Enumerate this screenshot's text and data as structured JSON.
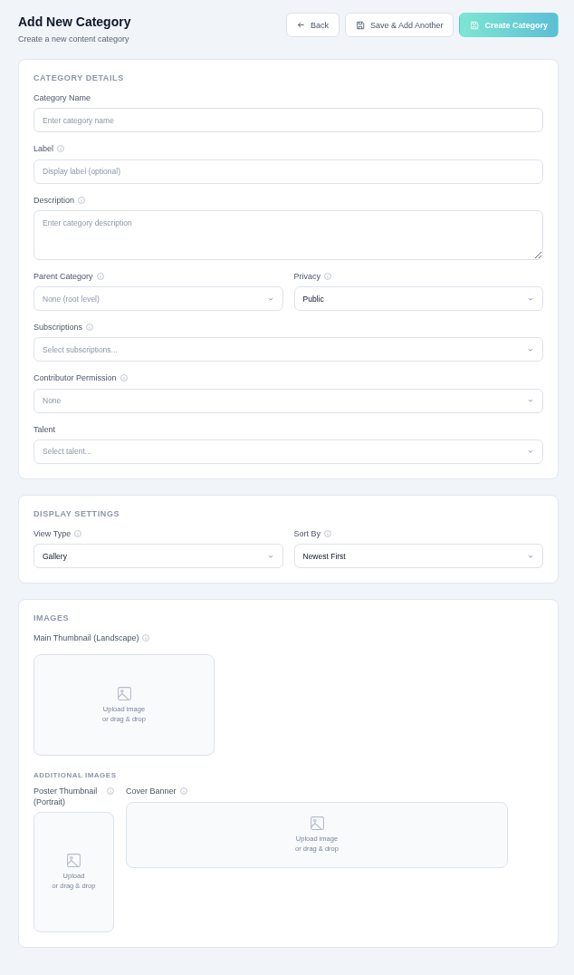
{
  "header": {
    "title": "Add New Category",
    "subtitle": "Create a new content category"
  },
  "actions": [
    {
      "label": "Back",
      "kind": "back"
    },
    {
      "label": "Save & Add Another",
      "kind": "secondary"
    },
    {
      "label": "Create Category",
      "kind": "primary"
    }
  ],
  "sections": [
    {
      "title": "CATEGORY DETAILS",
      "rows": [
        [
          {
            "label": "Category Name",
            "info": false,
            "kind": "input",
            "placeholder": "Enter category name"
          }
        ],
        [
          {
            "label": "Label",
            "info": true,
            "kind": "input",
            "placeholder": "Display label (optional)"
          }
        ],
        [
          {
            "label": "Description",
            "info": true,
            "kind": "textarea",
            "placeholder": "Enter category description"
          }
        ],
        [
          {
            "label": "Parent Category",
            "info": true,
            "kind": "select",
            "placeholder": "None (root level)"
          },
          {
            "label": "Privacy",
            "info": true,
            "kind": "select",
            "value": "Public"
          }
        ],
        [
          {
            "label": "Subscriptions",
            "info": true,
            "kind": "select",
            "placeholder": "Select subscriptions..."
          }
        ],
        [
          {
            "label": "Contributor Permission",
            "info": true,
            "kind": "select",
            "placeholder": "None"
          }
        ],
        [
          {
            "label": "Talent",
            "info": false,
            "kind": "select",
            "placeholder": "Select talent..."
          }
        ]
      ]
    },
    {
      "title": "DISPLAY SETTINGS",
      "rows": [
        [
          {
            "label": "View Type",
            "info": true,
            "kind": "select",
            "value": "Gallery"
          },
          {
            "label": "Sort By",
            "info": true,
            "kind": "select",
            "value": "Newest First"
          }
        ]
      ]
    }
  ],
  "images": {
    "title": "IMAGES",
    "main": {
      "label": "Main Thumbnail (Landscape)",
      "info": true,
      "kind": "landscape",
      "text": [
        "Upload image",
        "or drag & drop"
      ]
    },
    "additional_title": "ADDITIONAL IMAGES",
    "additional": [
      {
        "label": "Poster Thumbnail (Portrait)",
        "info": true,
        "kind": "portrait",
        "text": [
          "Upload",
          "or drag & drop"
        ]
      },
      {
        "label": "Cover Banner",
        "info": true,
        "kind": "banner",
        "text": [
          "Upload image",
          "or drag & drop"
        ]
      }
    ]
  }
}
